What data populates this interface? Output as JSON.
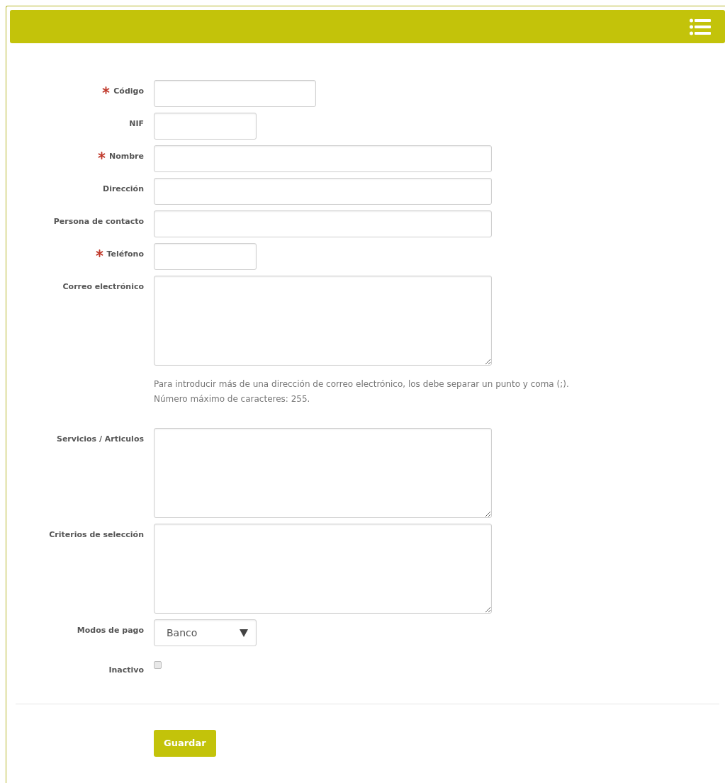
{
  "fields": [
    {
      "kind": "medium",
      "label": "Código",
      "required": true
    },
    {
      "kind": "short",
      "label": "NIF",
      "required": false
    },
    {
      "kind": "wide",
      "label": "Nombre",
      "required": true
    },
    {
      "kind": "wide",
      "label": "Dirección",
      "required": false
    },
    {
      "kind": "wide",
      "label": "Persona de contacto",
      "required": false
    },
    {
      "kind": "short",
      "label": "Teléfono",
      "required": true
    },
    {
      "kind": "textarea",
      "label": "Correo electrónico",
      "required": false,
      "help": [
        "Para introducir más de una dirección de correo electrónico, los debe separar un punto y coma (;).",
        "Número máximo de caracteres: 255."
      ]
    },
    {
      "kind": "textarea",
      "label": "Servicios / Articulos",
      "required": false
    },
    {
      "kind": "textarea",
      "label": "Criterios de selección",
      "required": false
    },
    {
      "kind": "select",
      "label": "Modos de pago",
      "required": false,
      "value": "Banco"
    },
    {
      "kind": "checkbox",
      "label": "Inactivo",
      "required": false,
      "checked": false
    }
  ],
  "save_button": "Guardar"
}
